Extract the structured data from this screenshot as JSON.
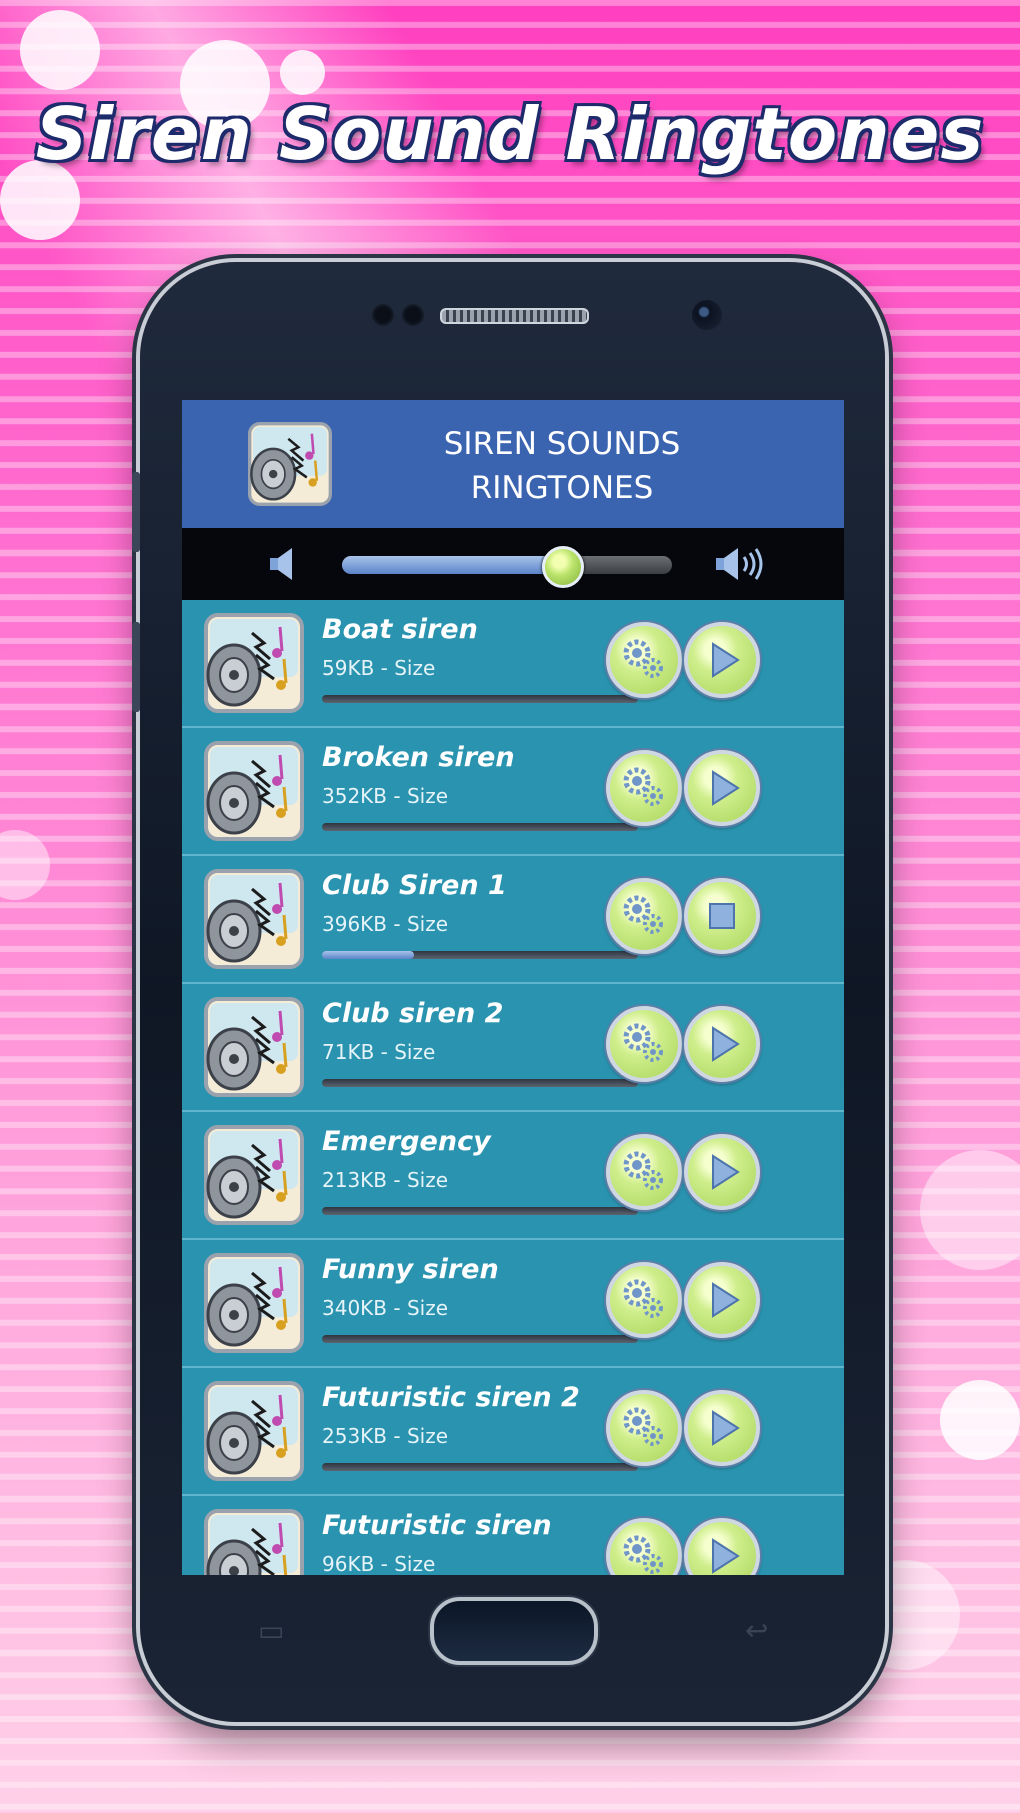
{
  "promo": {
    "headline": "Siren Sound Ringtones"
  },
  "app": {
    "title_line1": "SIREN SOUNDS",
    "title_line2": "RINGTONES",
    "icon": "speaker-siren-icon"
  },
  "volume": {
    "level": 0.66,
    "mute_icon": "volume-low-icon",
    "max_icon": "volume-high-icon"
  },
  "ringtones": [
    {
      "name": "Boat siren",
      "size": "59KB - Size",
      "progress": 0,
      "action": "play"
    },
    {
      "name": "Broken siren",
      "size": "352KB - Size",
      "progress": 0,
      "action": "play"
    },
    {
      "name": "Club Siren 1",
      "size": "396KB - Size",
      "progress": 0.29,
      "action": "stop"
    },
    {
      "name": "Club siren 2",
      "size": "71KB - Size",
      "progress": 0,
      "action": "play"
    },
    {
      "name": "Emergency",
      "size": "213KB - Size",
      "progress": 0,
      "action": "play"
    },
    {
      "name": "Funny siren",
      "size": "340KB - Size",
      "progress": 0,
      "action": "play"
    },
    {
      "name": "Futuristic siren 2",
      "size": "253KB - Size",
      "progress": 0,
      "action": "play"
    },
    {
      "name": "Futuristic siren",
      "size": "96KB - Size",
      "progress": 0,
      "action": "play"
    }
  ],
  "colors": {
    "header": "#3a63b0",
    "list_bg": "#2a94b0",
    "button": "#cfee8c"
  }
}
